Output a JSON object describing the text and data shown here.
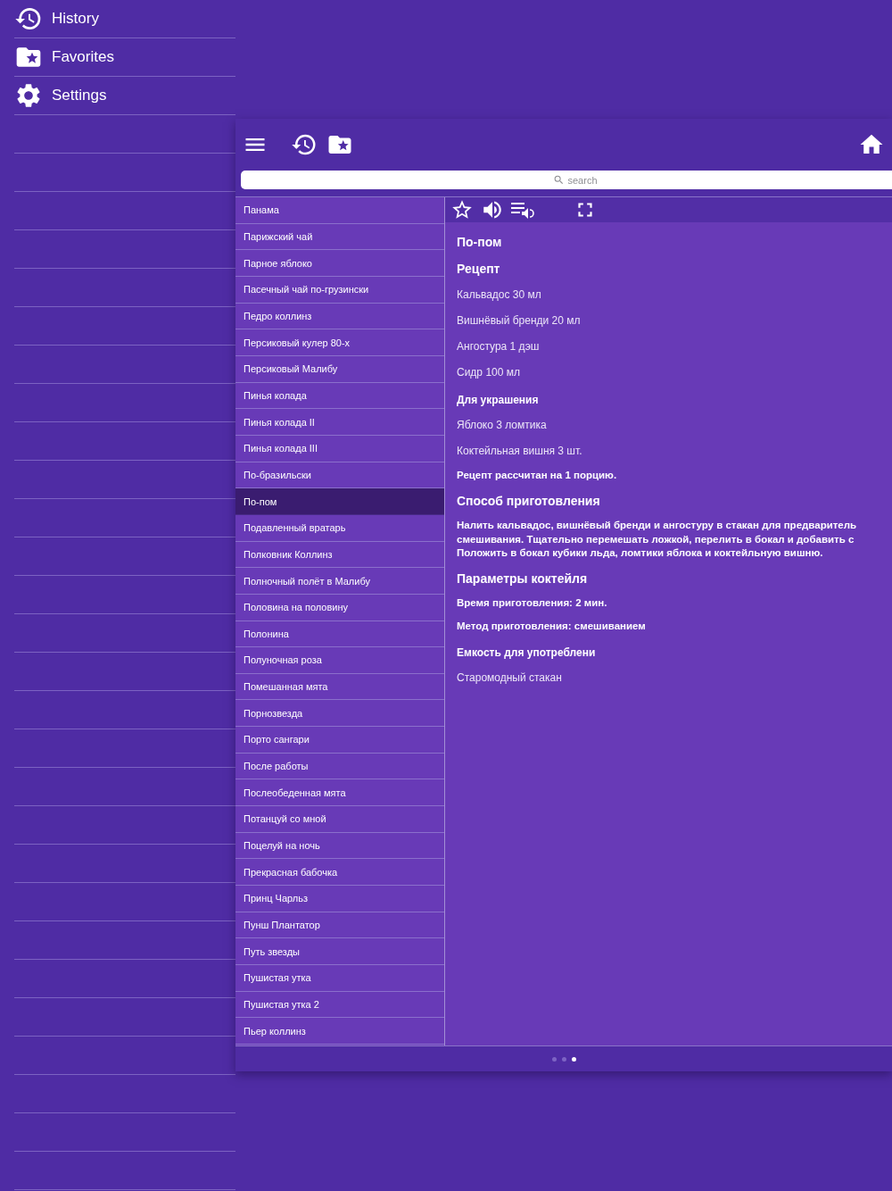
{
  "side_menu": [
    {
      "label": "History",
      "kind": "history"
    },
    {
      "label": "Favorites",
      "kind": "favorites"
    },
    {
      "label": "Settings",
      "kind": "settings"
    }
  ],
  "search": {
    "placeholder": "search"
  },
  "cocktails": [
    {
      "label": "Панама",
      "selected": false
    },
    {
      "label": "Парижский чай",
      "selected": false
    },
    {
      "label": "Парное яблоко",
      "selected": false
    },
    {
      "label": "Пасечный чай по-грузински",
      "selected": false
    },
    {
      "label": "Педро коллинз",
      "selected": false
    },
    {
      "label": "Персиковый кулер 80-х",
      "selected": false
    },
    {
      "label": "Персиковый Малибу",
      "selected": false
    },
    {
      "label": "Пинья колада",
      "selected": false
    },
    {
      "label": "Пинья колада II",
      "selected": false
    },
    {
      "label": "Пинья колада III",
      "selected": false
    },
    {
      "label": "По-бразильски",
      "selected": false
    },
    {
      "label": "По-пом",
      "selected": true
    },
    {
      "label": "Подавленный вратарь",
      "selected": false
    },
    {
      "label": "Полковник Коллинз",
      "selected": false
    },
    {
      "label": "Полночный полёт в Малибу",
      "selected": false
    },
    {
      "label": "Половина на половину",
      "selected": false
    },
    {
      "label": "Полонина",
      "selected": false
    },
    {
      "label": "Полуночная роза",
      "selected": false
    },
    {
      "label": "Помешанная мята",
      "selected": false
    },
    {
      "label": "Порнозвезда",
      "selected": false
    },
    {
      "label": "Порто сангари",
      "selected": false
    },
    {
      "label": "После работы",
      "selected": false
    },
    {
      "label": "Послеобеденная мята",
      "selected": false
    },
    {
      "label": "Потанцуй со мной",
      "selected": false
    },
    {
      "label": "Поцелуй на ночь",
      "selected": false
    },
    {
      "label": "Прекрасная бабочка",
      "selected": false
    },
    {
      "label": "Принц Чарльз",
      "selected": false
    },
    {
      "label": "Пунш Плантатор",
      "selected": false
    },
    {
      "label": "Путь звезды",
      "selected": false
    },
    {
      "label": "Пушистая утка",
      "selected": false
    },
    {
      "label": "Пушистая утка 2",
      "selected": false
    },
    {
      "label": "Пьер коллинз",
      "selected": false
    }
  ],
  "detail": [
    {
      "kind": "title",
      "text": "По-пом"
    },
    {
      "kind": "heading",
      "text": "Рецепт"
    },
    {
      "kind": "text",
      "text": "Кальвадос 30 мл"
    },
    {
      "kind": "text",
      "text": "Вишнёвый бренди 20 мл"
    },
    {
      "kind": "text",
      "text": "Ангостура 1 дэш"
    },
    {
      "kind": "text",
      "text": "Сидр 100 мл"
    },
    {
      "kind": "subheading",
      "text": "Для украшения"
    },
    {
      "kind": "text",
      "text": "Яблоко 3 ломтика"
    },
    {
      "kind": "text",
      "text": "Коктейльная вишня 3 шт."
    },
    {
      "kind": "bold",
      "text": "Рецепт рассчитан на 1 порцию."
    },
    {
      "kind": "heading",
      "text": "Способ приготовления"
    },
    {
      "kind": "paragraph",
      "text": "Налить кальвадос, вишнёвый бренди и ангостуру в стакан для предваритель\nсмешивания. Тщательно перемешать ложкой, перелить в бокал и добавить с\nПоложить в бокал кубики льда, ломтики яблока и коктейльную вишню."
    },
    {
      "kind": "heading",
      "text": "Параметры коктейля"
    },
    {
      "kind": "bold",
      "text": "Время приготовления: 2 мин."
    },
    {
      "kind": "bold",
      "text": "Метод приготовления: смешиванием"
    },
    {
      "kind": "subheading",
      "text": "Емкость для употреблени"
    },
    {
      "kind": "text",
      "text": "Старомодный стакан"
    }
  ],
  "pages": [
    {
      "selected": false
    },
    {
      "selected": false
    },
    {
      "selected": true
    }
  ]
}
